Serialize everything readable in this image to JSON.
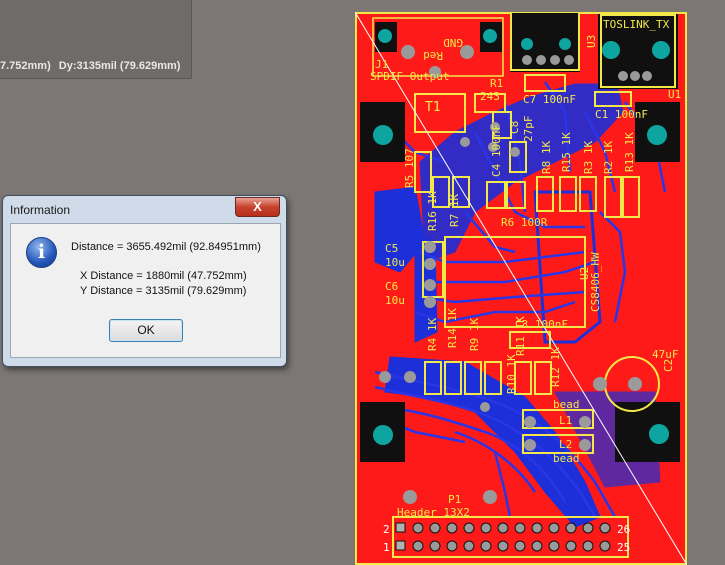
{
  "hud": {
    "dist_x": "7.752mm)",
    "dist_y": "Dy:3135mil (79.629mm)"
  },
  "dialog": {
    "title": "Information",
    "close_symbol": "X",
    "icon_glyph": "i",
    "distance": "Distance = 3655.492mil (92.84951mm)",
    "x_distance": "X Distance = 1880mil (47.752mm)",
    "y_distance": "Y Distance = 3135mil (79.629mm)",
    "ok_label": "OK"
  },
  "pcb": {
    "labels": {
      "j1": "J1",
      "spdif": "SPDIF Output",
      "red": "Red",
      "gnd": "GND",
      "r1": "R1",
      "r1_val": "243",
      "toslink": "TOSLINK_TX",
      "u3": "U3",
      "u1": "U1",
      "c7": "C7 100nF",
      "c1": "C1 100nF",
      "t1": "T1",
      "c8": "C8",
      "c8_val": "27pF",
      "c4": "C4 100nF",
      "r8": "R8 1K",
      "r15": "R15 1K",
      "r3": "R3 1K",
      "r2": "R2 1K",
      "r13": "R13 1K",
      "r5": "R5 107",
      "r16": "R16 1K",
      "r7": "R7 1K",
      "r6": "R6 100R",
      "c5": "C5",
      "c5_val": "10u",
      "c6": "C6",
      "c6_val": "10u",
      "u2": "U2",
      "u2_val": "CS8406_HW",
      "c3": "C3 100nF",
      "r4": "R4 1K",
      "r14": "R14 1K",
      "r9": "R9 1K",
      "r11": "R11 1K",
      "r10": "R10 1K",
      "r12": "R12 1K",
      "c2_val": "47uF",
      "c2": "C2",
      "l1_bead": "bead",
      "l1": "L1",
      "l2": "L2",
      "l2_bead": "bead",
      "p1": "P1",
      "header": "Header 13X2",
      "pin2": "2",
      "pin1": "1",
      "pin26": "26",
      "pin25": "25"
    }
  }
}
